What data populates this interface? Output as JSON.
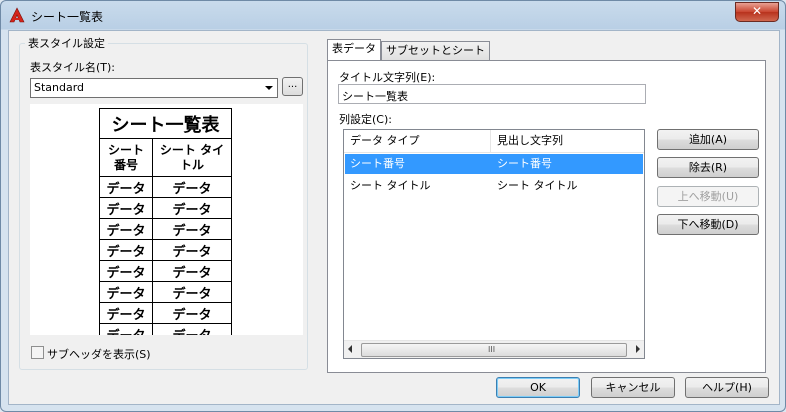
{
  "window": {
    "title": "シート一覧表",
    "close_glyph": "✕",
    "app_icon": "autocad-a-icon"
  },
  "left_panel": {
    "group_title": "表スタイル設定",
    "style_name_label": "表スタイル名(T):",
    "style_value": "Standard",
    "browse_label": "...",
    "preview": {
      "title": "シート一覧表",
      "header1": "シート\n番号",
      "header2": "シート タイ\nトル",
      "cell": "データ",
      "rows": 8
    },
    "subheader_checkbox": {
      "label": "サブヘッダを表示(S)",
      "checked": false
    }
  },
  "tabs": [
    {
      "label": "表データ",
      "active": true
    },
    {
      "label": "サブセットとシート",
      "active": false
    }
  ],
  "table_data": {
    "title_label": "タイトル文字列(E):",
    "title_value": "シート一覧表",
    "columns_label": "列設定(C):",
    "list_headers": [
      "データ タイプ",
      "見出し文字列"
    ],
    "list_rows": [
      {
        "type": "シート番号",
        "heading": "シート番号",
        "selected": true
      },
      {
        "type": "シート タイトル",
        "heading": "シート タイトル",
        "selected": false
      }
    ],
    "scroll_grip": "III",
    "buttons": {
      "add": "追加(A)",
      "remove": "除去(R)",
      "move_up": "上へ移動(U)",
      "move_down": "下へ移動(D)"
    }
  },
  "footer": {
    "ok": "OK",
    "cancel": "キャンセル",
    "help": "ヘルプ(H)"
  },
  "colors": {
    "selection": "#3399ff",
    "close_button": "#c9452f"
  }
}
